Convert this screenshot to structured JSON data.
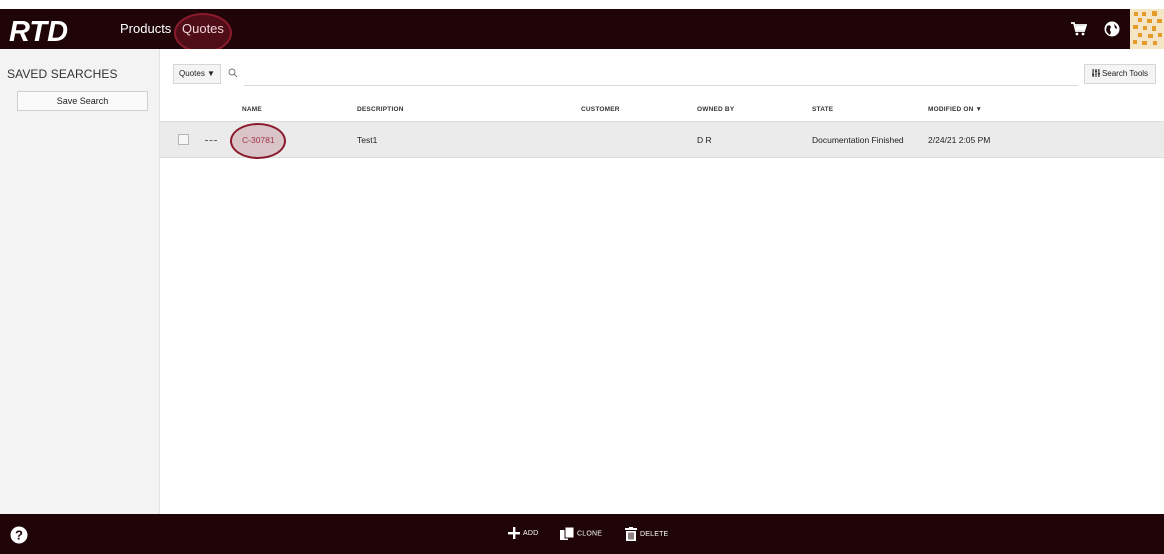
{
  "brand": {
    "logo_text": "RTD"
  },
  "nav": {
    "products": "Products",
    "quotes": "Quotes"
  },
  "header_icons": {
    "cart": "cart-icon",
    "globe": "globe-icon",
    "avatar": "user-avatar"
  },
  "sidebar": {
    "title": "SAVED SEARCHES",
    "save_button": "Save Search"
  },
  "toolbar": {
    "type_filter": "Quotes ▼",
    "search_placeholder": "",
    "search_tools": "Search Tools"
  },
  "table": {
    "columns": [
      "NAME",
      "DESCRIPTION",
      "CUSTOMER",
      "OWNED BY",
      "STATE",
      "MODIFIED ON ▼"
    ],
    "rows": [
      {
        "name": "C-30781",
        "description": "Test1",
        "customer": "",
        "owned_by": "D R",
        "state": "Documentation Finished",
        "modified_on": "2/24/21 2:05 PM"
      }
    ]
  },
  "bottom_actions": {
    "add": "ADD",
    "clone": "CLONE",
    "delete": "DELETE"
  },
  "colors": {
    "bar_bg": "#1f0507",
    "accent": "#8a1a2c",
    "link": "#a33548"
  }
}
